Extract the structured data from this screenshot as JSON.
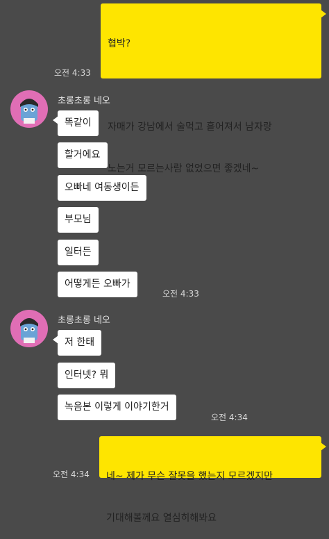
{
  "messages": {
    "top_out": {
      "line1": "협박?",
      "line2": "자매가 강남에서 술먹고 흩어져서 남자랑",
      "line3": "노는거 모르는사람 없었으면 좋겠네~",
      "time": "오전 4:33"
    },
    "group1": {
      "sender": "초롱초롱 네오",
      "items": [
        "똑같이",
        "할거에요",
        "오빠네 여동생이든",
        "부모님",
        "일터든",
        "어떻게든 오빠가"
      ],
      "time": "오전 4:33"
    },
    "group2": {
      "sender": "초롱초롱 네오",
      "items": [
        "저 한태",
        "인터넷? 뭐",
        "녹음본 이렇게 이야기한거"
      ],
      "time": "오전 4:34"
    },
    "bottom_out": {
      "line1": "네~ 제가 무슨 잘못을 했는지 모르겠지만",
      "line2": "기대해볼께요 열심히해봐요",
      "time": "오전 4:34"
    }
  },
  "avatar": {
    "icon": "neo-character-icon",
    "bg_color": "#e06eb5"
  },
  "colors": {
    "background": "#4a4a4a",
    "outgoing_bubble": "#fee500",
    "incoming_bubble": "#ffffff"
  }
}
